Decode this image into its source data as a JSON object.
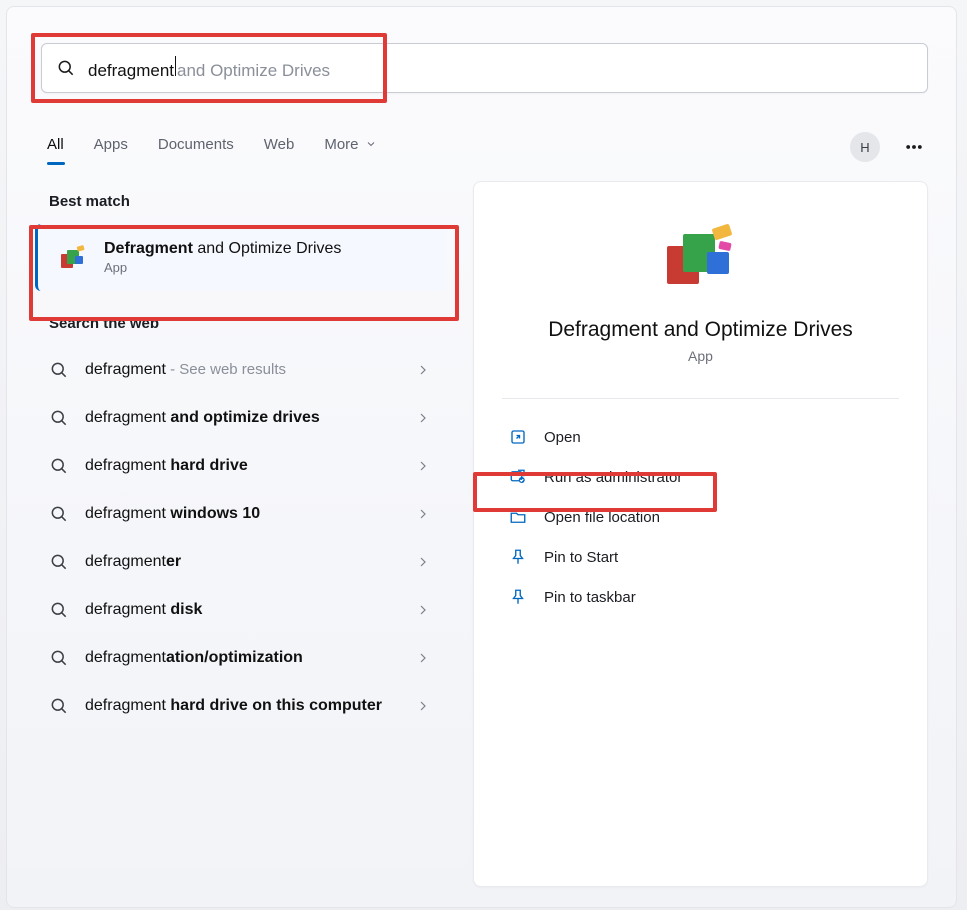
{
  "search": {
    "typed": "defragment",
    "ghost": " and Optimize Drives"
  },
  "filters": {
    "all": "All",
    "apps": "Apps",
    "documents": "Documents",
    "web": "Web",
    "more": "More"
  },
  "user": {
    "initial": "H"
  },
  "sections": {
    "best_match": "Best match",
    "search_web": "Search the web"
  },
  "best_match": {
    "title_bold": "Defragment",
    "title_rest": " and Optimize Drives",
    "subtitle": "App"
  },
  "web_results": [
    {
      "plain": "defragment",
      "bold": "",
      "suffix_sub": " - See web results"
    },
    {
      "plain": "defragment ",
      "bold": "and optimize drives",
      "suffix_sub": ""
    },
    {
      "plain": "defragment ",
      "bold": "hard drive",
      "suffix_sub": ""
    },
    {
      "plain": "defragment ",
      "bold": "windows 10",
      "suffix_sub": ""
    },
    {
      "plain": "defragment",
      "bold": "er",
      "suffix_sub": ""
    },
    {
      "plain": "defragment ",
      "bold": "disk",
      "suffix_sub": ""
    },
    {
      "plain": "defragment",
      "bold": "ation/optimization",
      "suffix_sub": ""
    },
    {
      "plain": "defragment ",
      "bold": "hard drive on this computer",
      "suffix_sub": ""
    }
  ],
  "detail": {
    "title": "Defragment and Optimize Drives",
    "subtitle": "App",
    "actions": {
      "open": "Open",
      "run_admin": "Run as administrator",
      "open_loc": "Open file location",
      "pin_start": "Pin to Start",
      "pin_taskbar": "Pin to taskbar"
    }
  }
}
